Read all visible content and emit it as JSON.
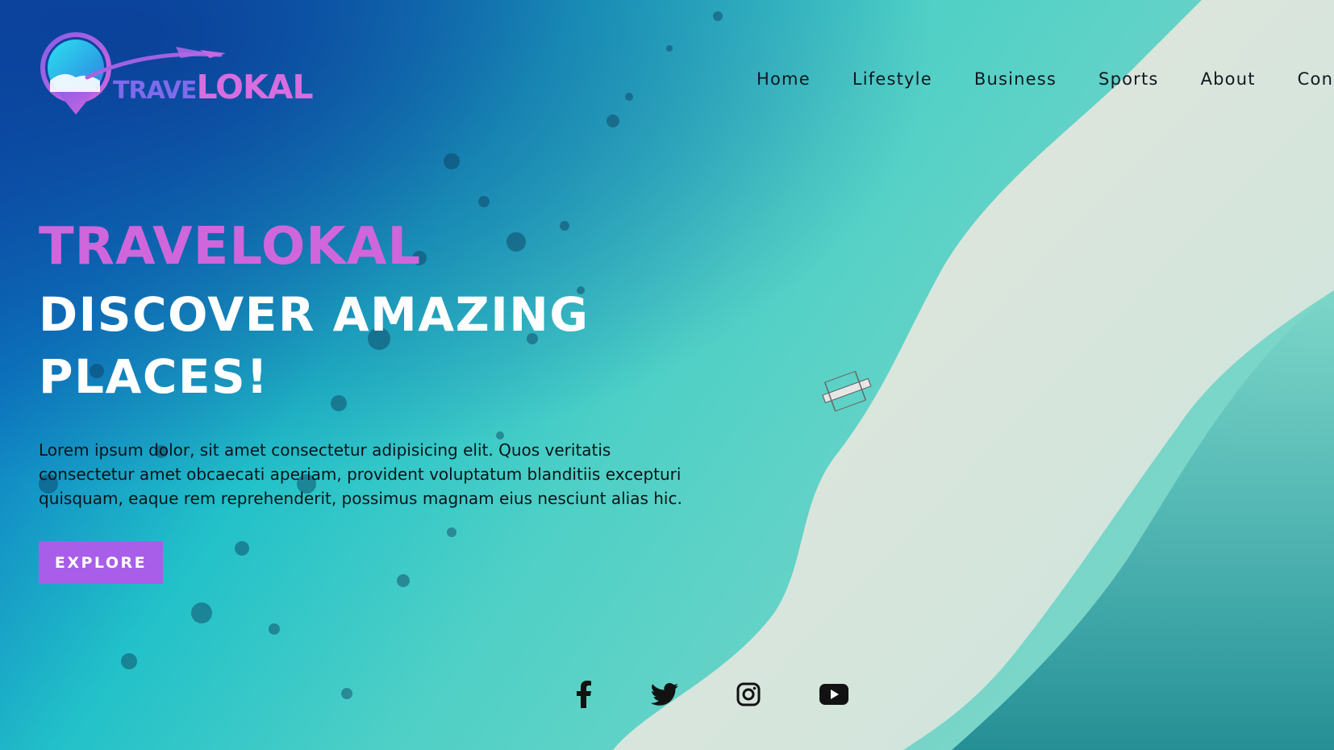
{
  "brand": {
    "logo_part1": "TRAVE",
    "logo_part2": "LOKAL",
    "colors": {
      "magenta": "#d066dc",
      "purple": "#a85ee8",
      "cyan": "#2bd4e0"
    }
  },
  "nav": {
    "items": [
      {
        "label": "Home"
      },
      {
        "label": "Lifestyle"
      },
      {
        "label": "Business"
      },
      {
        "label": "Sports"
      },
      {
        "label": "About"
      },
      {
        "label": "Con"
      }
    ]
  },
  "hero": {
    "brand": "TRAVELOKAL",
    "title": "DISCOVER AMAZING PLACES!",
    "description": "Lorem ipsum dolor, sit amet consectetur adipisicing elit. Quos veritatis consectetur amet obcaecati aperiam, provident voluptatum blanditiis excepturi quisquam, eaque rem reprehenderit, possimus magnam eius nesciunt alias hic.",
    "cta_label": "EXPLORE"
  },
  "social": {
    "icons": [
      "facebook-icon",
      "twitter-icon",
      "instagram-icon",
      "youtube-icon"
    ]
  }
}
